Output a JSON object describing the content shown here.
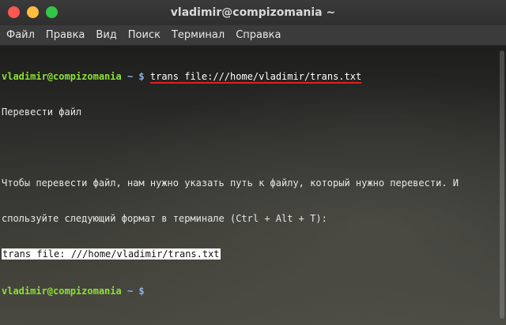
{
  "window": {
    "title": "vladimir@compizomania ~"
  },
  "menu": [
    "Файл",
    "Правка",
    "Вид",
    "Поиск",
    "Терминал",
    "Справка"
  ],
  "terminal": {
    "prompt_user": "vladimir@compizomania",
    "prompt_path": "~ $",
    "command": "trans file:///home/vladimir/trans.txt",
    "output_1": "Перевести файл",
    "output_2": "",
    "output_3": "Чтобы перевести файл, нам нужно указать путь к файлу, который нужно перевести. И",
    "output_4": "спользуйте следующий формат в терминале (Ctrl + Alt + T):",
    "output_5_highlight": "trans file: ///home/vladimir/trans.txt",
    "prompt2_user": "vladimir@compizomania",
    "prompt2_path": "~ $"
  },
  "colors": {
    "prompt_user": "#8ae234",
    "prompt_path": "#8fb4e0",
    "underline": "#e02020",
    "close": "#fc5753",
    "minimize": "#fdbc40",
    "maximize": "#33c748"
  }
}
